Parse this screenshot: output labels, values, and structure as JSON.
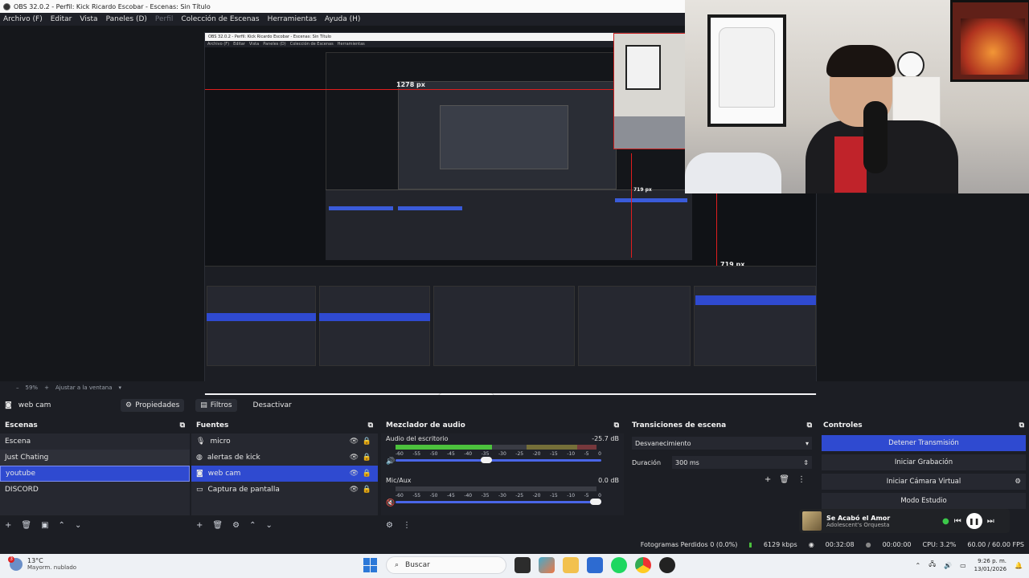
{
  "window": {
    "title": "OBS 32.0.2 - Perfil: Kick Ricardo Escobar - Escenas: Sin Título"
  },
  "menu": {
    "items": [
      "Archivo (F)",
      "Editar",
      "Vista",
      "Paneles (D)",
      "Perfil",
      "Colección de Escenas",
      "Herramientas",
      "Ayuda (H)"
    ]
  },
  "preview": {
    "label_width": "1278 px",
    "label_height": "719 px",
    "label_height_2": "719 px",
    "inner_title": "OBS 32.0.2 - Perfil: Kick Ricardo Escobar - Escenas: Sin Título"
  },
  "zoom": {
    "percent": "59%",
    "plus": "+",
    "fit_label": "Ajustar a la ventana"
  },
  "source_bar": {
    "source_name": "web cam",
    "properties_label": "Propiedades",
    "filters_label": "Filtros",
    "deactivate_label": "Desactivar"
  },
  "scenes": {
    "title": "Escenas",
    "items": [
      "Escena",
      "Just Chating",
      "youtube",
      "DISCORD"
    ],
    "selected_index": 2
  },
  "sources": {
    "title": "Fuentes",
    "items": [
      "micro",
      "alertas de kick",
      "web cam",
      "Captura de pantalla"
    ],
    "selected_index": 2
  },
  "mixer": {
    "title": "Mezclador de audio",
    "tracks": [
      {
        "name": "Audio del escritorio",
        "db": "-25.7 dB",
        "level": 0.48,
        "volume": 0.44
      },
      {
        "name": "Mic/Aux",
        "db": "0.0 dB",
        "level": 0.0,
        "volume": 1.0
      }
    ],
    "ticks": [
      "-60",
      "-55",
      "-50",
      "-45",
      "-40",
      "-35",
      "-30",
      "-25",
      "-20",
      "-15",
      "-10",
      "-5",
      "0"
    ]
  },
  "transitions": {
    "title": "Transiciones de escena",
    "selected": "Desvanecimiento",
    "duration_label": "Duración",
    "duration_value": "300 ms"
  },
  "controls": {
    "title": "Controles",
    "stop_stream": "Detener Transmisión",
    "start_recording": "Iniciar Grabación",
    "start_virtual_cam": "Iniciar Cámara Virtual",
    "studio_mode": "Modo Estudio"
  },
  "music": {
    "song": "Se Acabó el Amor",
    "artist": "Adolescent's Orquesta"
  },
  "status": {
    "dropped_frames": "Fotogramas Perdidos 0 (0.0%)",
    "bitrate": "6129 kbps",
    "stream_time": "00:32:08",
    "record_time": "00:00:00",
    "cpu": "CPU: 3.2%",
    "fps": "60.00 / 60.00 FPS"
  },
  "taskbar": {
    "badge": "3",
    "temperature": "13°C",
    "condition": "Mayorm. nublado",
    "search_placeholder": "Buscar",
    "time": "9:26 p. m.",
    "date": "13/01/2026"
  },
  "colors": {
    "accent_blue": "#2f4ad0",
    "meter_green": "#4cc23d",
    "meter_yellow": "#bfae2c",
    "meter_red": "#c23232",
    "measure_red": "#e01e1e"
  }
}
